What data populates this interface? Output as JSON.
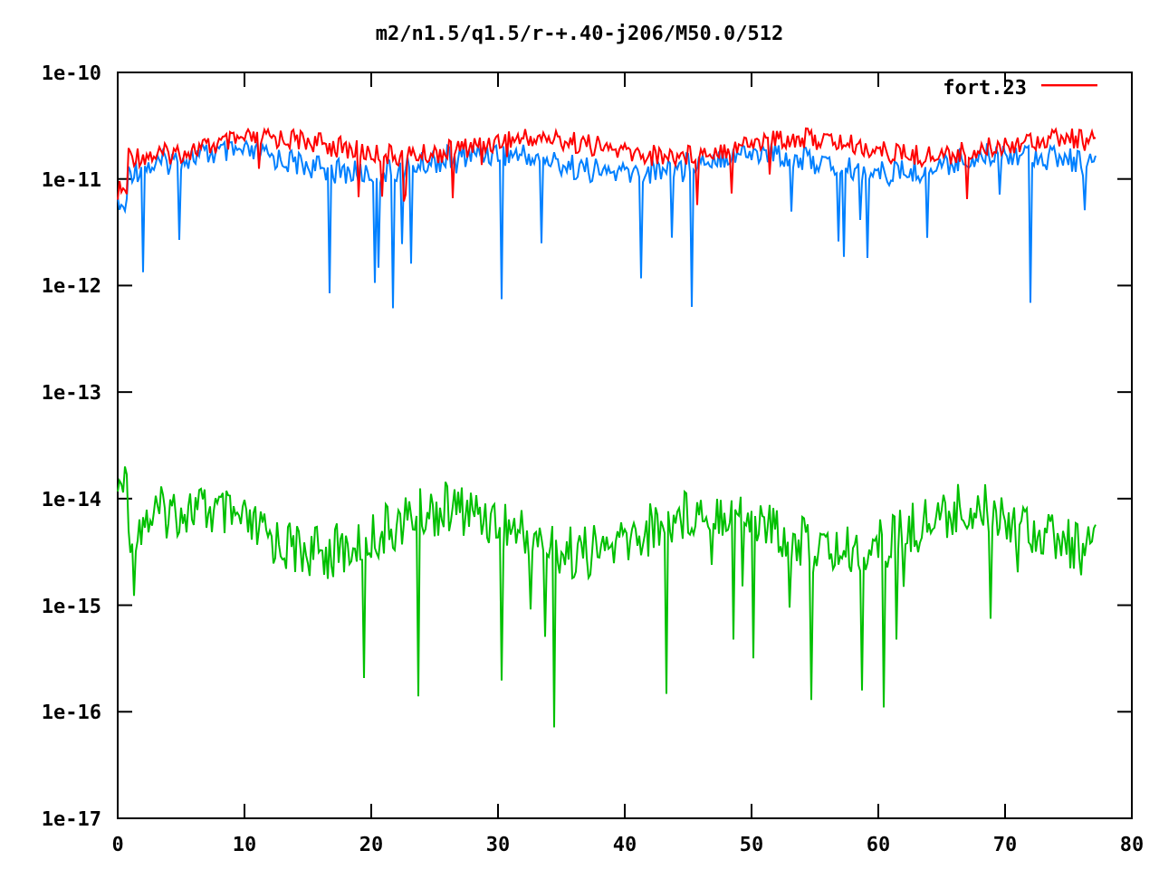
{
  "plot": {
    "title": "m2/n1.5/q1.5/r-+.40-j206/M50.0/512",
    "y_tick_labels": [
      "1e-10",
      "1e-11",
      "1e-12",
      "1e-13",
      "1e-14",
      "1e-15",
      "1e-16",
      "1e-17"
    ],
    "x_tick_labels": [
      "0",
      "10",
      "20",
      "30",
      "40",
      "50",
      "60",
      "70",
      "80"
    ],
    "legend": [
      {
        "label": "fort.23",
        "color": "#ff0000"
      }
    ]
  }
}
